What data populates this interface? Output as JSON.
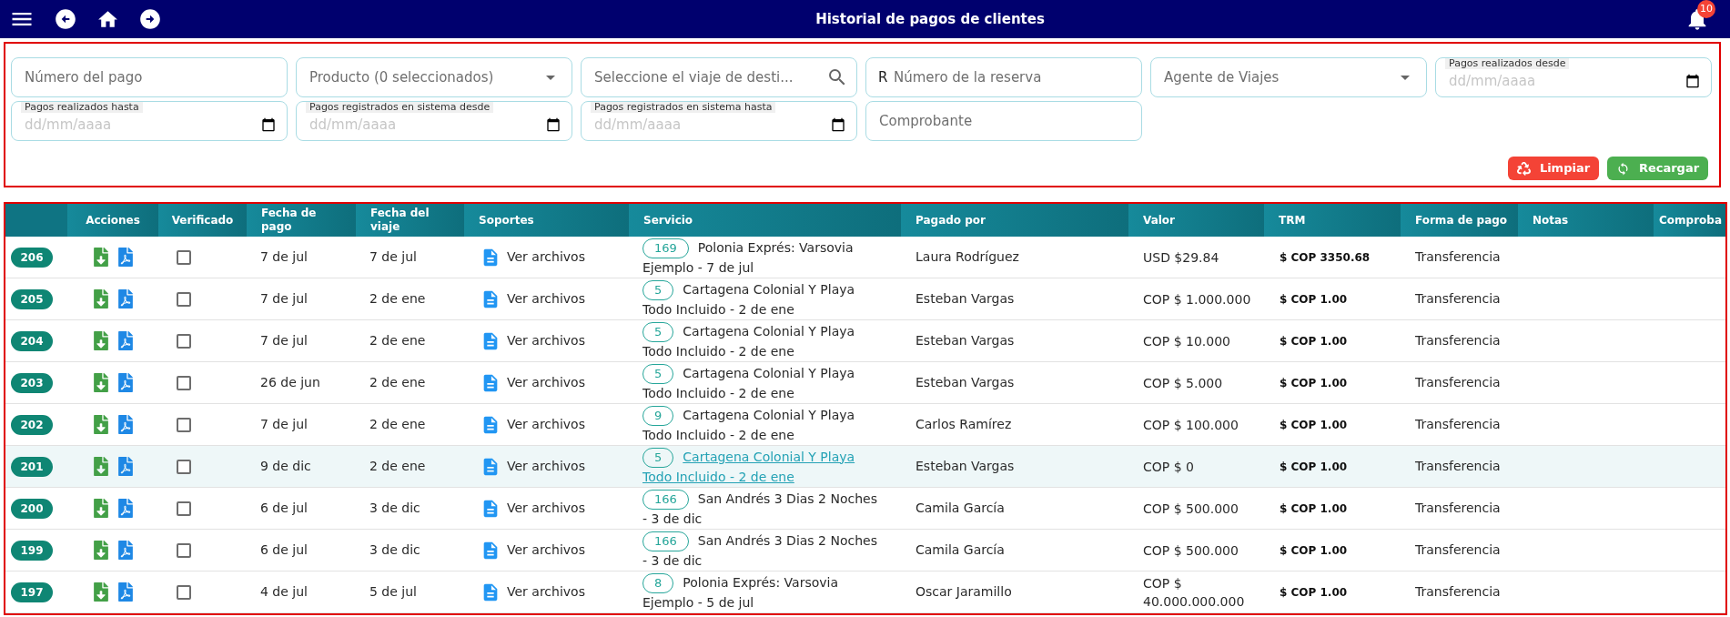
{
  "app_bar": {
    "title": "Historial de pagos de clientes",
    "notification_count": "10"
  },
  "filters": {
    "fields": [
      {
        "kind": "text",
        "placeholder": "Número del pago"
      },
      {
        "kind": "select",
        "placeholder": "Producto (0 seleccionados)"
      },
      {
        "kind": "search",
        "placeholder": "Seleccione el viaje de desti..."
      },
      {
        "kind": "prefixed",
        "prefix": "R",
        "placeholder": "Número de la reserva"
      },
      {
        "kind": "select",
        "placeholder": "Agente de Viajes"
      },
      {
        "kind": "date",
        "label": "Pagos realizados desde",
        "placeholder": "dd/mm/aaaa"
      },
      {
        "kind": "date",
        "label": "Pagos realizados hasta",
        "placeholder": "dd/mm/aaaa"
      },
      {
        "kind": "date",
        "label": "Pagos registrados en sistema desde",
        "placeholder": "dd/mm/aaaa"
      },
      {
        "kind": "date",
        "label": "Pagos registrados en sistema hasta",
        "placeholder": "dd/mm/aaaa"
      },
      {
        "kind": "text",
        "placeholder": "Comprobante"
      }
    ],
    "buttons": [
      {
        "kind": "clear",
        "label": "Limpiar"
      },
      {
        "kind": "reload",
        "label": "Recargar"
      }
    ]
  },
  "table": {
    "columns": [
      "Acciones",
      "Verificado",
      "Fecha de pago",
      "Fecha del viaje",
      "Soportes",
      "Servicio",
      "Pagado por",
      "Valor",
      "TRM",
      "Forma de pago",
      "Notas",
      "Comproba"
    ],
    "rows": [
      {
        "id": "206",
        "verified": false,
        "payment_date": "7 de jul",
        "trip_date": "7 de jul",
        "supports": "Ver archivos",
        "service_count": "169",
        "service": "Polonia Exprés: Varsovia Ejemplo - 7 de jul",
        "paid_by": "Laura Rodríguez",
        "amount": "USD $29.84",
        "trm": "$ COP 3350.68",
        "payment_method": "Transferencia",
        "hovered": false
      },
      {
        "id": "205",
        "verified": false,
        "payment_date": "7 de jul",
        "trip_date": "2 de ene",
        "supports": "Ver archivos",
        "service_count": "5",
        "service": "Cartagena Colonial Y Playa Todo Incluido - 2 de ene",
        "paid_by": "Esteban Vargas",
        "amount": "COP $ 1.000.000",
        "trm": "$ COP 1.00",
        "payment_method": "Transferencia",
        "hovered": false
      },
      {
        "id": "204",
        "verified": false,
        "payment_date": "7 de jul",
        "trip_date": "2 de ene",
        "supports": "Ver archivos",
        "service_count": "5",
        "service": "Cartagena Colonial Y Playa Todo Incluido - 2 de ene",
        "paid_by": "Esteban Vargas",
        "amount": "COP $ 10.000",
        "trm": "$ COP 1.00",
        "payment_method": "Transferencia",
        "hovered": false
      },
      {
        "id": "203",
        "verified": false,
        "payment_date": "26 de jun",
        "trip_date": "2 de ene",
        "supports": "Ver archivos",
        "service_count": "5",
        "service": "Cartagena Colonial Y Playa Todo Incluido - 2 de ene",
        "paid_by": "Esteban Vargas",
        "amount": "COP $ 5.000",
        "trm": "$ COP 1.00",
        "payment_method": "Transferencia",
        "hovered": false
      },
      {
        "id": "202",
        "verified": false,
        "payment_date": "7 de jul",
        "trip_date": "2 de ene",
        "supports": "Ver archivos",
        "service_count": "9",
        "service": "Cartagena Colonial Y Playa Todo Incluido - 2 de ene",
        "paid_by": "Carlos Ramírez",
        "amount": "COP $ 100.000",
        "trm": "$ COP 1.00",
        "payment_method": "Transferencia",
        "hovered": false
      },
      {
        "id": "201",
        "verified": false,
        "payment_date": "9 de dic",
        "trip_date": "2 de ene",
        "supports": "Ver archivos",
        "service_count": "5",
        "service": "Cartagena Colonial Y Playa Todo Incluido - 2 de ene",
        "paid_by": "Esteban Vargas",
        "amount": "COP $ 0",
        "trm": "$ COP 1.00",
        "payment_method": "Transferencia",
        "hovered": true
      },
      {
        "id": "200",
        "verified": false,
        "payment_date": "6 de jul",
        "trip_date": "3 de dic",
        "supports": "Ver archivos",
        "service_count": "166",
        "service": "San Andrés 3 Dias 2 Noches - 3 de dic",
        "paid_by": "Camila García",
        "amount": "COP $ 500.000",
        "trm": "$ COP 1.00",
        "payment_method": "Transferencia",
        "hovered": false
      },
      {
        "id": "199",
        "verified": false,
        "payment_date": "6 de jul",
        "trip_date": "3 de dic",
        "supports": "Ver archivos",
        "service_count": "166",
        "service": "San Andrés 3 Dias 2 Noches - 3 de dic",
        "paid_by": "Camila García",
        "amount": "COP $ 500.000",
        "trm": "$ COP 1.00",
        "payment_method": "Transferencia",
        "hovered": false
      },
      {
        "id": "197",
        "verified": false,
        "payment_date": "4 de jul",
        "trip_date": "5 de jul",
        "supports": "Ver archivos",
        "service_count": "8",
        "service": "Polonia Exprés: Varsovia Ejemplo - 5 de jul",
        "paid_by": "Oscar Jaramillo",
        "amount": "COP $ 40.000.000.000",
        "trm": "$ COP 1.00",
        "payment_method": "Transferencia",
        "hovered": false
      }
    ]
  }
}
